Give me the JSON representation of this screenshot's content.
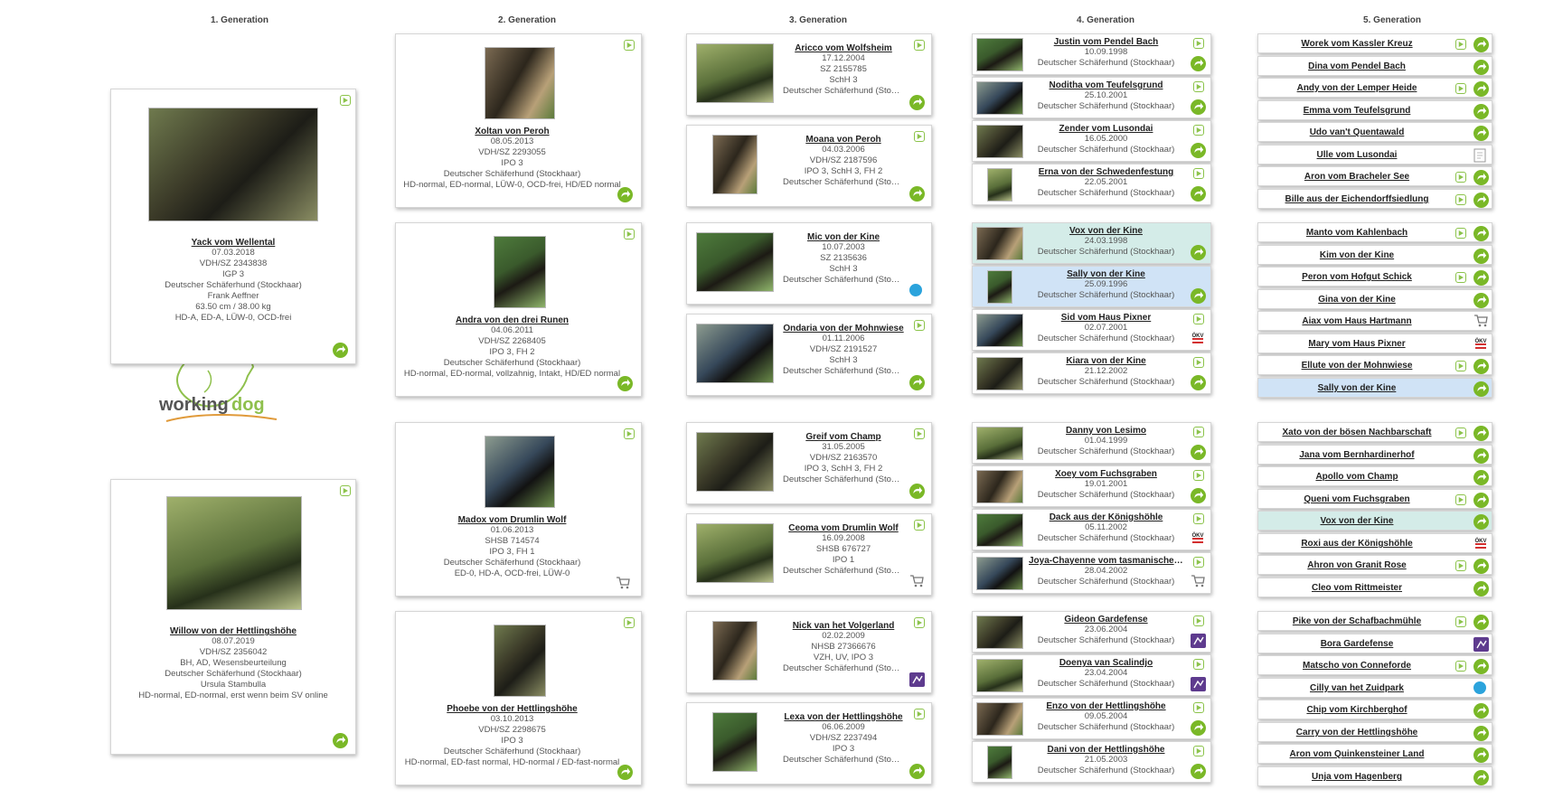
{
  "headers": [
    "1. Generation",
    "2. Generation",
    "3. Generation",
    "4. Generation",
    "5. Generation"
  ],
  "logo_text": "working dog",
  "gen1": [
    {
      "name": "Yack vom Wellental",
      "lines": [
        "07.03.2018",
        "VDH/SZ 2343838",
        "IGP 3",
        "Deutscher Schäferhund (Stockhaar)",
        "Frank Aeffner",
        "63.50 cm / 38.00 kg",
        "HD-A, ED-A, LÜW-0, OCD-frei"
      ],
      "photo": "dark dog lying in heather"
    },
    {
      "name": "Willow von der Hettlingshöhe",
      "lines": [
        "08.07.2019",
        "VDH/SZ 2356042",
        "BH, AD, Wesensbeurteilung",
        "Deutscher Schäferhund (Stockhaar)",
        "Ursula Stambulla",
        "HD-normal, ED-normal, erst wenn beim SV online"
      ],
      "photo": "black dog lying on grass"
    }
  ],
  "gen2": [
    {
      "name": "Xoltan von Peroh",
      "lines": [
        "08.05.2013",
        "VDH/SZ 2293055",
        "IPO 3",
        "Deutscher Schäferhund (Stockhaar)",
        "HD-normal, ED-normal, LÜW-0, OCD-frei, HD/ED normal"
      ],
      "photo": "dog lying on field"
    },
    {
      "name": "Andra von den drei Runen",
      "lines": [
        "04.06.2011",
        "VDH/SZ 2268405",
        "IPO 3, FH 2",
        "Deutscher Schäferhund (Stockhaar)",
        "HD-normal, ED-normal, vollzahnig, Intakt, HD/ED normal"
      ],
      "photo": "handler with dog"
    },
    {
      "name": "Madox vom Drumlin Wolf",
      "lines": [
        "01.06.2013",
        "SHSB 714574",
        "IPO 3, FH 1",
        "Deutscher Schäferhund (Stockhaar)",
        "ED-0, HD-A, OCD-frei, LÜW-0"
      ],
      "photo": "dog behind fence"
    },
    {
      "name": "Phoebe von der Hettlingshöhe",
      "lines": [
        "03.10.2013",
        "VDH/SZ 2298675",
        "IPO 3",
        "Deutscher Schäferhund (Stockhaar)",
        "HD-normal, ED-fast normal, HD-normal / ED-fast-normal"
      ],
      "photo": "black dog sitting"
    }
  ],
  "gen3": [
    {
      "name": "Aricco vom Wolfsheim",
      "lines": [
        "17.12.2004",
        "SZ 2155785",
        "SchH 3",
        "Deutscher Schäferhund (Stockhaar)"
      ],
      "badge": "more"
    },
    {
      "name": "Moana von Peroh",
      "lines": [
        "04.03.2006",
        "VDH/SZ 2187596",
        "IPO 3, SchH 3, FH 2",
        "Deutscher Schäferhund (Stockhaar)"
      ],
      "badge": "more"
    },
    {
      "name": "Mic von der Kine",
      "lines": [
        "10.07.2003",
        "SZ 2135636",
        "SchH 3",
        "Deutscher Schäferhund (Stockhaar)"
      ],
      "badge": "blue"
    },
    {
      "name": "Ondaria von der Mohnwiese",
      "lines": [
        "01.11.2006",
        "VDH/SZ 2191527",
        "SchH 3",
        "Deutscher Schäferhund (Stockhaar)"
      ],
      "badge": "more"
    },
    {
      "name": "Greif vom Champ",
      "lines": [
        "31.05.2005",
        "VDH/SZ 2163570",
        "IPO 3, SchH 3, FH 2",
        "Deutscher Schäferhund (Stockhaar)"
      ],
      "badge": "more"
    },
    {
      "name": "Ceoma vom Drumlin Wolf",
      "lines": [
        "16.09.2008",
        "SHSB 676727",
        "IPO 1",
        "Deutscher Schäferhund (Stockhaar)"
      ],
      "badge": "cart"
    },
    {
      "name": "Nick van het Volgerland",
      "lines": [
        "02.02.2009",
        "NHSB 27366676",
        "VZH, UV, IPO 3",
        "Deutscher Schäferhund (Stockhaar)"
      ],
      "badge": "purple"
    },
    {
      "name": "Lexa von der Hettlingshöhe",
      "lines": [
        "06.06.2009",
        "VDH/SZ 2237494",
        "IPO 3",
        "Deutscher Schäferhund (Stockhaar)"
      ],
      "badge": "more"
    }
  ],
  "gen4": [
    {
      "name": "Justin vom Pendel Bach",
      "date": "10.09.1998",
      "breed": "Deutscher Schäferhund (Stockhaar)",
      "badge": "more",
      "hl": ""
    },
    {
      "name": "Noditha vom Teufelsgrund",
      "date": "25.10.2001",
      "breed": "Deutscher Schäferhund (Stockhaar)",
      "badge": "more",
      "hl": ""
    },
    {
      "name": "Zender vom Lusondai",
      "date": "16.05.2000",
      "breed": "Deutscher Schäferhund (Stockhaar)",
      "badge": "more",
      "hl": ""
    },
    {
      "name": "Erna von der Schwedenfestung",
      "date": "22.05.2001",
      "breed": "Deutscher Schäferhund (Stockhaar)",
      "badge": "more",
      "hl": ""
    },
    {
      "name": "Vox von der Kine",
      "date": "24.03.1998",
      "breed": "Deutscher Schäferhund (Stockhaar)",
      "badge": "more",
      "hl": "teal"
    },
    {
      "name": "Sally von der Kine",
      "date": "25.09.1996",
      "breed": "Deutscher Schäferhund (Stockhaar)",
      "badge": "more",
      "hl": "blue"
    },
    {
      "name": "Sid vom Haus Pixner",
      "date": "02.07.2001",
      "breed": "Deutscher Schäferhund (Stockhaar)",
      "badge": "okv",
      "hl": ""
    },
    {
      "name": "Kiara von der Kine",
      "date": "21.12.2002",
      "breed": "Deutscher Schäferhund (Stockhaar)",
      "badge": "more",
      "hl": ""
    },
    {
      "name": "Danny von Lesimo",
      "date": "01.04.1999",
      "breed": "Deutscher Schäferhund (Stockhaar)",
      "badge": "more",
      "hl": ""
    },
    {
      "name": "Xoey vom Fuchsgraben",
      "date": "19.01.2001",
      "breed": "Deutscher Schäferhund (Stockhaar)",
      "badge": "more",
      "hl": ""
    },
    {
      "name": "Dack aus der Königshöhle",
      "date": "05.11.2002",
      "breed": "Deutscher Schäferhund (Stockhaar)",
      "badge": "okv",
      "hl": ""
    },
    {
      "name": "Joya-Chayenne vom tasmanischen Tiger",
      "date": "28.04.2002",
      "breed": "Deutscher Schäferhund (Stockhaar)",
      "badge": "cart",
      "hl": ""
    },
    {
      "name": "Gideon Gardefense",
      "date": "23.06.2004",
      "breed": "Deutscher Schäferhund (Stockhaar)",
      "badge": "purple",
      "hl": ""
    },
    {
      "name": "Doenya van Scalindjo",
      "date": "23.04.2004",
      "breed": "Deutscher Schäferhund (Stockhaar)",
      "badge": "purple",
      "hl": ""
    },
    {
      "name": "Enzo von der Hettlingshöhe",
      "date": "09.05.2004",
      "breed": "Deutscher Schäferhund (Stockhaar)",
      "badge": "more",
      "hl": ""
    },
    {
      "name": "Dani von der Hettlingshöhe",
      "date": "21.05.2003",
      "breed": "Deutscher Schäferhund (Stockhaar)",
      "badge": "more",
      "hl": ""
    }
  ],
  "gen5": [
    {
      "name": "Worek vom Kassler Kreuz",
      "badge": "more",
      "play": true,
      "hl": ""
    },
    {
      "name": "Dina vom Pendel Bach",
      "badge": "more",
      "play": false,
      "hl": ""
    },
    {
      "name": "Andy von der Lemper Heide",
      "badge": "more",
      "play": true,
      "hl": ""
    },
    {
      "name": "Emma vom Teufelsgrund",
      "badge": "more",
      "play": false,
      "hl": ""
    },
    {
      "name": "Udo van't Quentawald",
      "badge": "more",
      "play": false,
      "hl": ""
    },
    {
      "name": "Ulle vom Lusondai",
      "badge": "doc",
      "play": false,
      "hl": ""
    },
    {
      "name": "Aron vom Bracheler See",
      "badge": "more",
      "play": true,
      "hl": ""
    },
    {
      "name": "Bille aus der Eichendorffsiedlung",
      "badge": "more",
      "play": true,
      "hl": ""
    },
    {
      "name": "Manto vom Kahlenbach",
      "badge": "more",
      "play": true,
      "hl": ""
    },
    {
      "name": "Kim von der Kine",
      "badge": "more",
      "play": false,
      "hl": ""
    },
    {
      "name": "Peron vom Hofgut Schick",
      "badge": "more",
      "play": true,
      "hl": ""
    },
    {
      "name": "Gina von der Kine",
      "badge": "more",
      "play": false,
      "hl": ""
    },
    {
      "name": "Aiax vom Haus Hartmann",
      "badge": "cart",
      "play": false,
      "hl": ""
    },
    {
      "name": "Mary vom Haus Pixner",
      "badge": "okv",
      "play": false,
      "hl": ""
    },
    {
      "name": "Ellute von der Mohnwiese",
      "badge": "more",
      "play": true,
      "hl": ""
    },
    {
      "name": "Sally von der Kine",
      "badge": "more",
      "play": false,
      "hl": "blue"
    },
    {
      "name": "Xato von der bösen Nachbarschaft",
      "badge": "more",
      "play": true,
      "hl": ""
    },
    {
      "name": "Jana vom Bernhardinerhof",
      "badge": "more",
      "play": false,
      "hl": ""
    },
    {
      "name": "Apollo vom Champ",
      "badge": "more",
      "play": false,
      "hl": ""
    },
    {
      "name": "Queni vom Fuchsgraben",
      "badge": "more",
      "play": true,
      "hl": ""
    },
    {
      "name": "Vox von der Kine",
      "badge": "more",
      "play": false,
      "hl": "teal"
    },
    {
      "name": "Roxi aus der Königshöhle",
      "badge": "okv",
      "play": false,
      "hl": ""
    },
    {
      "name": "Ahron von Granit Rose",
      "badge": "more",
      "play": true,
      "hl": ""
    },
    {
      "name": "Cleo vom Rittmeister",
      "badge": "more",
      "play": false,
      "hl": ""
    },
    {
      "name": "Pike von der Schafbachmühle",
      "badge": "more",
      "play": true,
      "hl": ""
    },
    {
      "name": "Bora Gardefense",
      "badge": "purple",
      "play": false,
      "hl": ""
    },
    {
      "name": "Matscho von Conneforde",
      "badge": "more",
      "play": true,
      "hl": ""
    },
    {
      "name": "Cilly van het Zuidpark",
      "badge": "blue",
      "play": false,
      "hl": ""
    },
    {
      "name": "Chip vom Kirchberghof",
      "badge": "more",
      "play": false,
      "hl": ""
    },
    {
      "name": "Carry von der Hettlingshöhe",
      "badge": "more",
      "play": false,
      "hl": ""
    },
    {
      "name": "Aron vom Quinkensteiner Land",
      "badge": "more",
      "play": false,
      "hl": ""
    },
    {
      "name": "Unja vom Hagenberg",
      "badge": "more",
      "play": false,
      "hl": ""
    }
  ]
}
